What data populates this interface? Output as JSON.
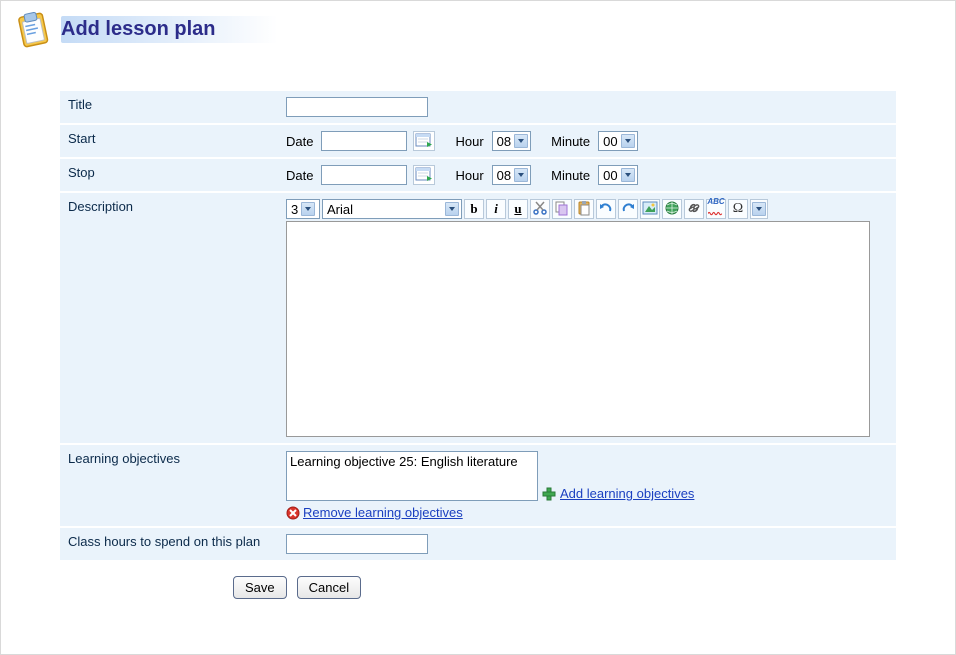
{
  "header": {
    "title": "Add lesson plan"
  },
  "form": {
    "title": {
      "label": "Title",
      "value": ""
    },
    "start": {
      "label": "Start",
      "date_label": "Date",
      "date_value": "",
      "hour_label": "Hour",
      "hour_value": "08",
      "minute_label": "Minute",
      "minute_value": "00"
    },
    "stop": {
      "label": "Stop",
      "date_label": "Date",
      "date_value": "",
      "hour_label": "Hour",
      "hour_value": "08",
      "minute_label": "Minute",
      "minute_value": "00"
    },
    "description": {
      "label": "Description",
      "font_size": "3",
      "font_name": "Arial",
      "value": ""
    },
    "learning_objectives": {
      "label": "Learning objectives",
      "items": [
        "Learning objective 25: English literature"
      ],
      "add_link": "Add learning objectives",
      "remove_link": "Remove learning objectives"
    },
    "class_hours": {
      "label": "Class hours to spend on this plan",
      "value": ""
    }
  },
  "toolbar": {
    "bold": "b",
    "italic": "i",
    "underline": "u",
    "spellcheck": "ABC"
  },
  "actions": {
    "save": "Save",
    "cancel": "Cancel"
  }
}
